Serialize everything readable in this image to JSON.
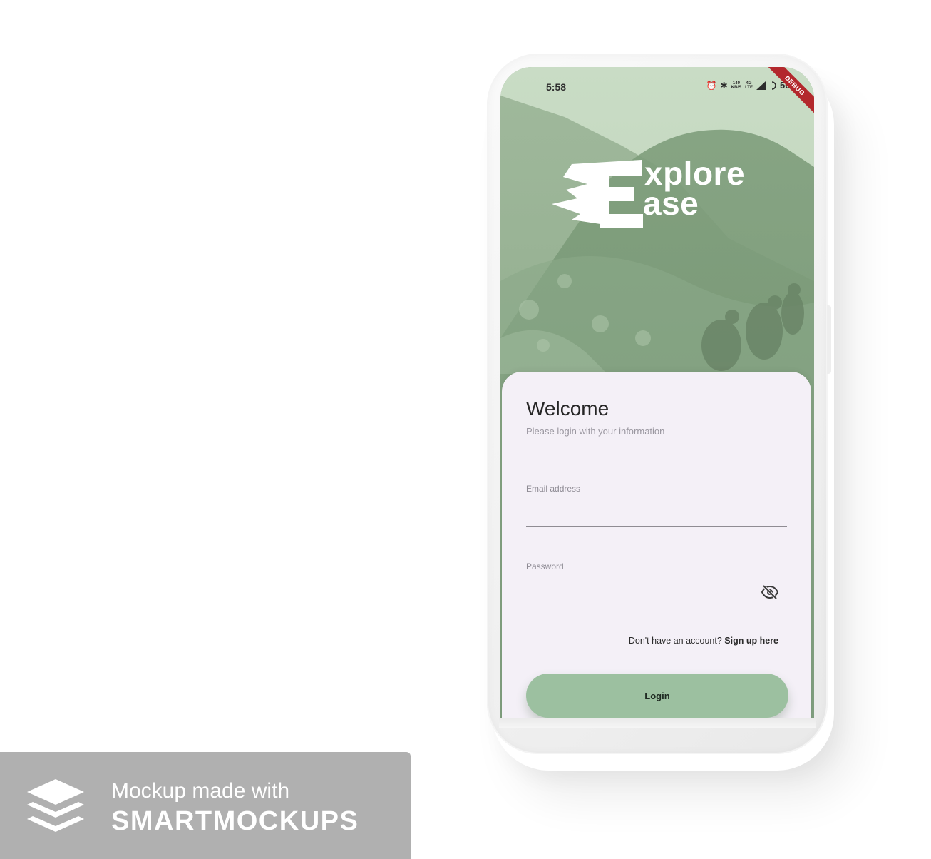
{
  "status_bar": {
    "time": "5:58",
    "net_speed_top": "140",
    "net_speed_bottom": "KB/S",
    "network_top": "4G",
    "network_bottom": "LTE",
    "battery": "50%"
  },
  "debug_banner": "DEBUG",
  "app": {
    "logo_line1": "xplore",
    "logo_line2": "ase"
  },
  "login": {
    "title": "Welcome",
    "subtitle": "Please login with your information",
    "email_label": "Email address",
    "email_value": "",
    "password_label": "Password",
    "password_value": "",
    "signup_prompt": "Don't have an account?",
    "signup_link": "Sign up here",
    "login_button": "Login"
  },
  "watermark": {
    "line1": "Mockup made with",
    "line2": "SMARTMOCKUPS"
  },
  "colors": {
    "card_bg": "#f4f0f7",
    "login_button": "#9cc0a0",
    "debug_ribbon": "#b3282d",
    "scenery_green": "#8fae8c",
    "badge_bg": "#b0b0b0"
  },
  "icons": {
    "password_toggle": "eye-off-icon",
    "alarm": "alarm-icon",
    "bluetooth": "bluetooth-icon",
    "signal": "signal-icon",
    "battery": "battery-icon",
    "watermark_logo": "layers-icon"
  }
}
